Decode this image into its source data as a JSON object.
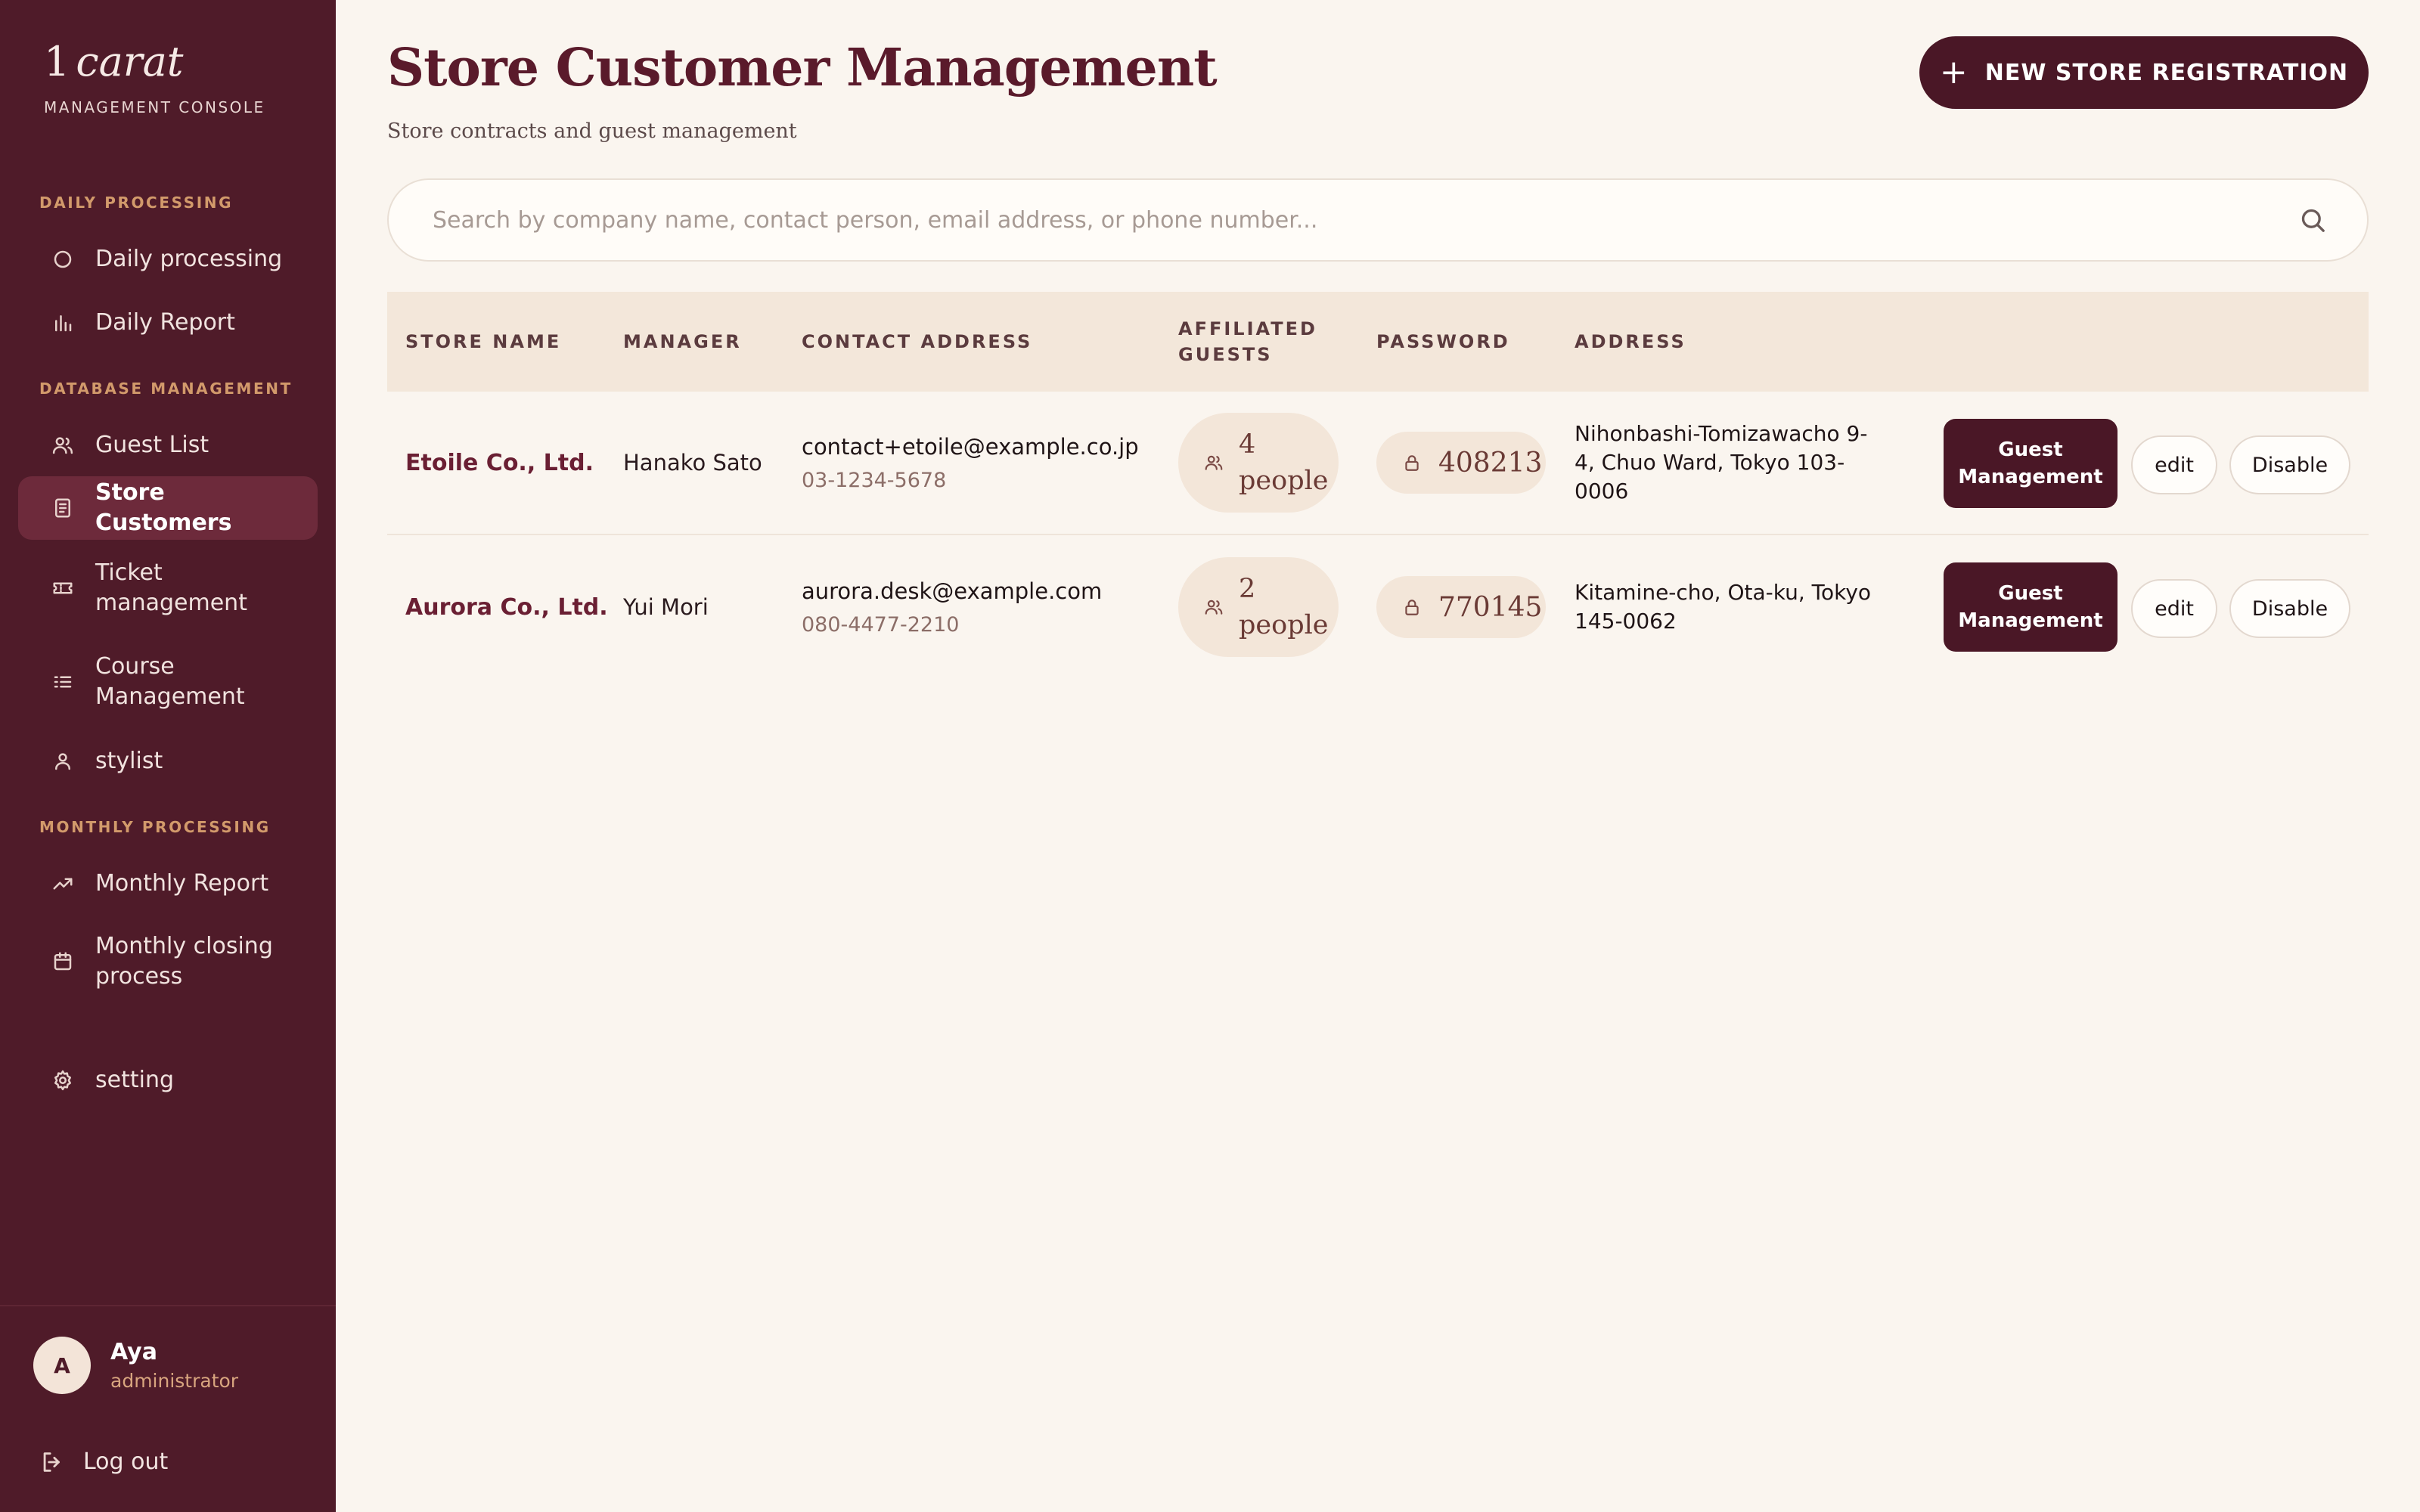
{
  "brand": {
    "number": "1",
    "word": "carat",
    "subtitle": "MANAGEMENT CONSOLE"
  },
  "sidebar": {
    "sections": {
      "daily": "DAILY PROCESSING",
      "database": "DATABASE MANAGEMENT",
      "monthly": "MONTHLY PROCESSING"
    },
    "items": [
      {
        "label": "Daily processing",
        "icon": "circle-icon"
      },
      {
        "label": "Daily Report",
        "icon": "bar-chart-icon"
      },
      {
        "label": "Guest List",
        "icon": "users-icon"
      },
      {
        "label": "Store Customers",
        "icon": "document-icon",
        "active": true
      },
      {
        "label": "Ticket management",
        "icon": "ticket-icon"
      },
      {
        "label": "Course Management",
        "icon": "list-icon"
      },
      {
        "label": "stylist",
        "icon": "user-icon"
      },
      {
        "label": "Monthly Report",
        "icon": "trending-up-icon"
      },
      {
        "label": "Monthly closing process",
        "icon": "calendar-icon"
      },
      {
        "label": "setting",
        "icon": "gear-icon"
      }
    ],
    "user": {
      "initial": "A",
      "name": "Aya",
      "role": "administrator"
    },
    "logout_label": "Log out"
  },
  "header": {
    "title": "Store Customer Management",
    "subtitle": "Store contracts and guest management",
    "new_button_label": "NEW STORE REGISTRATION"
  },
  "search": {
    "placeholder": "Search by company name, contact person, email address, or phone number...",
    "value": ""
  },
  "table": {
    "columns": {
      "store_name": "STORE NAME",
      "manager": "MANAGER",
      "contact": "CONTACT ADDRESS",
      "guests": "AFFILIATED GUESTS",
      "password": "PASSWORD",
      "address": "ADDRESS"
    },
    "rows": [
      {
        "store_name": "Etoile Co., Ltd.",
        "manager": "Hanako Sato",
        "email": "contact+etoile@example.co.jp",
        "phone": "03-1234-5678",
        "guests": "4 people",
        "password": "408213",
        "address": "Nihonbashi-Tomizawacho 9-4, Chuo Ward, Tokyo 103-0006",
        "guest_button": "Guest Management",
        "edit_button": "edit",
        "disable_button": "Disable"
      },
      {
        "store_name": "Aurora Co., Ltd.",
        "manager": "Yui Mori",
        "email": "aurora.desk@example.com",
        "phone": "080-4477-2210",
        "guests": "2 people",
        "password": "770145",
        "address": "Kitamine-cho, Ota-ku, Tokyo 145-0062",
        "guest_button": "Guest Management",
        "edit_button": "edit",
        "disable_button": "Disable"
      }
    ]
  },
  "colors": {
    "sidebar_bg": "#4f1b29",
    "accent": "#4a1726",
    "section_label": "#d29a6b",
    "page_bg": "#faf5ef"
  }
}
